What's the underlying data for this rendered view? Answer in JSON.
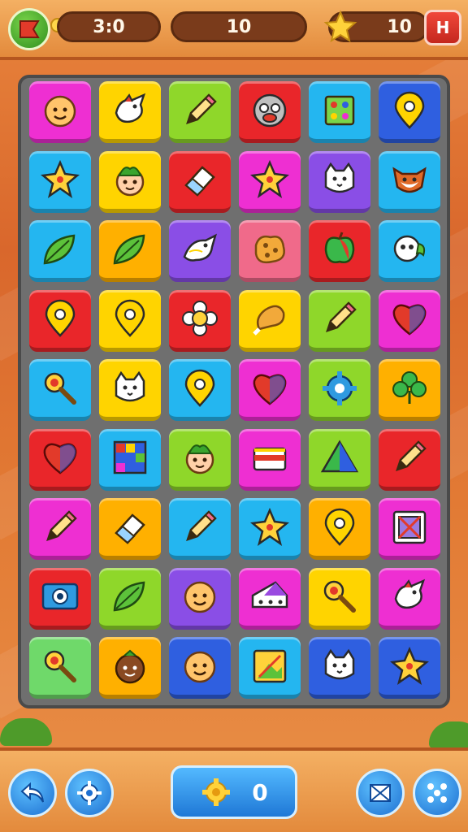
{
  "header": {
    "timer": "3:0",
    "moves": "10",
    "stars": "10",
    "exit_label": "H"
  },
  "footer": {
    "score": "0"
  },
  "colors": {
    "magenta": "#ee2fd2",
    "yellow": "#ffd400",
    "lime": "#8fd72a",
    "red": "#e9262a",
    "cyan": "#24b6f0",
    "blue": "#2f5fe0",
    "orange": "#ffb000",
    "purple": "#8a4ee6",
    "pink": "#f06a8a",
    "green": "#6fd96a"
  },
  "board": {
    "rows": [
      [
        {
          "color": "magenta",
          "icon": "face-icon"
        },
        {
          "color": "yellow",
          "icon": "bird-icon"
        },
        {
          "color": "lime",
          "icon": "pencil-icon"
        },
        {
          "color": "red",
          "icon": "owl-face-icon"
        },
        {
          "color": "cyan",
          "icon": "game-board-icon"
        },
        {
          "color": "blue",
          "icon": "map-pin-icon"
        }
      ],
      [
        {
          "color": "cyan",
          "icon": "star-icon"
        },
        {
          "color": "yellow",
          "icon": "boy-face-icon"
        },
        {
          "color": "red",
          "icon": "eraser-icon"
        },
        {
          "color": "magenta",
          "icon": "star-icon"
        },
        {
          "color": "purple",
          "icon": "cat-face-icon"
        },
        {
          "color": "cyan",
          "icon": "fox-face-icon"
        }
      ],
      [
        {
          "color": "cyan",
          "icon": "leaf-icon"
        },
        {
          "color": "orange",
          "icon": "leaf-icon"
        },
        {
          "color": "purple",
          "icon": "dragon-icon"
        },
        {
          "color": "pink",
          "icon": "cookie-icon"
        },
        {
          "color": "red",
          "icon": "apple-icon"
        },
        {
          "color": "cyan",
          "icon": "skull-icon"
        }
      ],
      [
        {
          "color": "red",
          "icon": "map-pin-icon"
        },
        {
          "color": "yellow",
          "icon": "map-pin-icon"
        },
        {
          "color": "red",
          "icon": "flower-icon"
        },
        {
          "color": "yellow",
          "icon": "chicken-leg-icon"
        },
        {
          "color": "lime",
          "icon": "pencil-icon"
        },
        {
          "color": "magenta",
          "icon": "heart-icon"
        }
      ],
      [
        {
          "color": "cyan",
          "icon": "magnifier-icon"
        },
        {
          "color": "yellow",
          "icon": "cat-face-icon"
        },
        {
          "color": "cyan",
          "icon": "map-pin-icon"
        },
        {
          "color": "magenta",
          "icon": "heart-icon"
        },
        {
          "color": "lime",
          "icon": "gear-icon"
        },
        {
          "color": "orange",
          "icon": "clover-icon"
        }
      ],
      [
        {
          "color": "red",
          "icon": "heart-icon"
        },
        {
          "color": "cyan",
          "icon": "tiles-icon"
        },
        {
          "color": "lime",
          "icon": "boy-face-icon"
        },
        {
          "color": "magenta",
          "icon": "cake-icon"
        },
        {
          "color": "lime",
          "icon": "triangle-icon"
        },
        {
          "color": "red",
          "icon": "pencil-icon"
        }
      ],
      [
        {
          "color": "magenta",
          "icon": "pencil-icon"
        },
        {
          "color": "orange",
          "icon": "eraser-icon"
        },
        {
          "color": "cyan",
          "icon": "pencil-icon"
        },
        {
          "color": "cyan",
          "icon": "star-icon"
        },
        {
          "color": "orange",
          "icon": "map-pin-icon"
        },
        {
          "color": "magenta",
          "icon": "box-icon"
        }
      ],
      [
        {
          "color": "red",
          "icon": "camera-icon"
        },
        {
          "color": "lime",
          "icon": "leaf-icon"
        },
        {
          "color": "purple",
          "icon": "face-icon"
        },
        {
          "color": "magenta",
          "icon": "cheese-icon"
        },
        {
          "color": "yellow",
          "icon": "magnifier-icon"
        },
        {
          "color": "magenta",
          "icon": "bird-icon"
        }
      ],
      [
        {
          "color": "green",
          "icon": "magnifier-icon"
        },
        {
          "color": "orange",
          "icon": "coconut-face-icon"
        },
        {
          "color": "blue",
          "icon": "face-icon"
        },
        {
          "color": "cyan",
          "icon": "picture-icon"
        },
        {
          "color": "blue",
          "icon": "cat-face-icon"
        },
        {
          "color": "blue",
          "icon": "star-icon"
        }
      ]
    ]
  }
}
